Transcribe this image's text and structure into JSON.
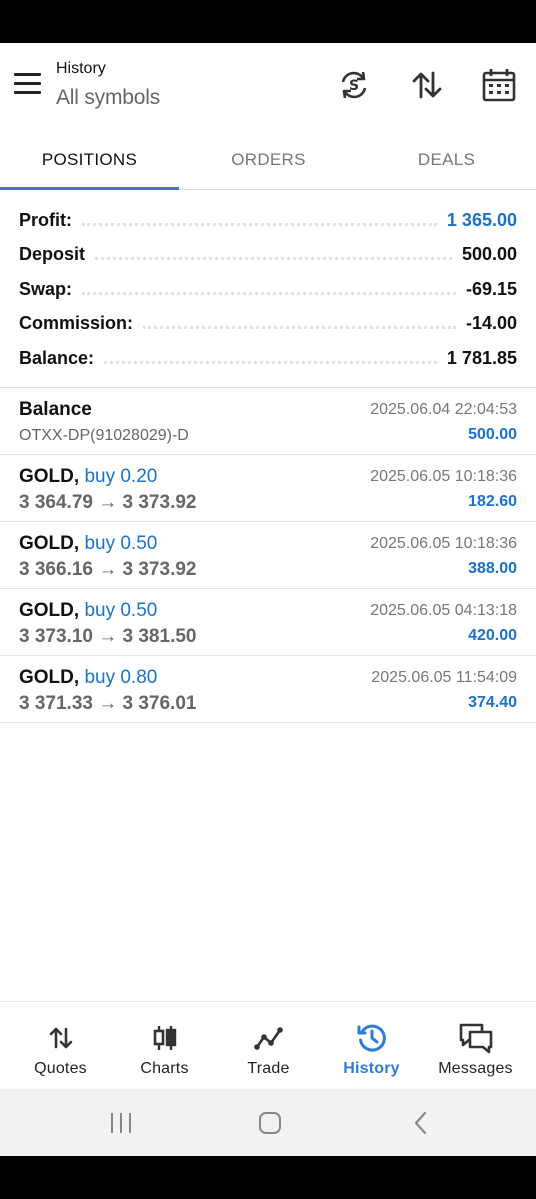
{
  "header": {
    "title": "History",
    "subtitle": "All symbols",
    "icons": [
      "currency-sync-icon",
      "sort-icon",
      "calendar-icon"
    ]
  },
  "tabs": [
    {
      "label": "POSITIONS",
      "active": true
    },
    {
      "label": "ORDERS",
      "active": false
    },
    {
      "label": "DEALS",
      "active": false
    }
  ],
  "summary": {
    "profit": {
      "label": "Profit:",
      "value": "1 365.00"
    },
    "deposit": {
      "label": "Deposit",
      "value": "500.00"
    },
    "swap": {
      "label": "Swap:",
      "value": "-69.15"
    },
    "commission": {
      "label": "Commission:",
      "value": "-14.00"
    },
    "balance": {
      "label": "Balance:",
      "value": "1 781.85"
    }
  },
  "entries": [
    {
      "symbol": "Balance",
      "side": "",
      "detail": "OTXX-DP(91028029)-D",
      "time": "2025.06.04 22:04:53",
      "amount": "500.00"
    },
    {
      "symbol": "GOLD,",
      "side": "buy 0.20",
      "detail": "3 364.79 → 3 373.92",
      "time": "2025.06.05 10:18:36",
      "amount": "182.60"
    },
    {
      "symbol": "GOLD,",
      "side": "buy 0.50",
      "detail": "3 366.16 → 3 373.92",
      "time": "2025.06.05 10:18:36",
      "amount": "388.00"
    },
    {
      "symbol": "GOLD,",
      "side": "buy 0.50",
      "detail": "3 373.10 → 3 381.50",
      "time": "2025.06.05 04:13:18",
      "amount": "420.00"
    },
    {
      "symbol": "GOLD,",
      "side": "buy 0.80",
      "detail": "3 371.33 → 3 376.01",
      "time": "2025.06.05 11:54:09",
      "amount": "374.40"
    }
  ],
  "bottom_nav": [
    {
      "label": "Quotes",
      "icon": "quotes-icon",
      "active": false
    },
    {
      "label": "Charts",
      "icon": "charts-icon",
      "active": false
    },
    {
      "label": "Trade",
      "icon": "trade-icon",
      "active": false
    },
    {
      "label": "History",
      "icon": "history-icon",
      "active": true
    },
    {
      "label": "Messages",
      "icon": "messages-icon",
      "active": false
    }
  ],
  "colors": {
    "accent": "#2e7cd6",
    "value_blue": "#1a73c8"
  }
}
